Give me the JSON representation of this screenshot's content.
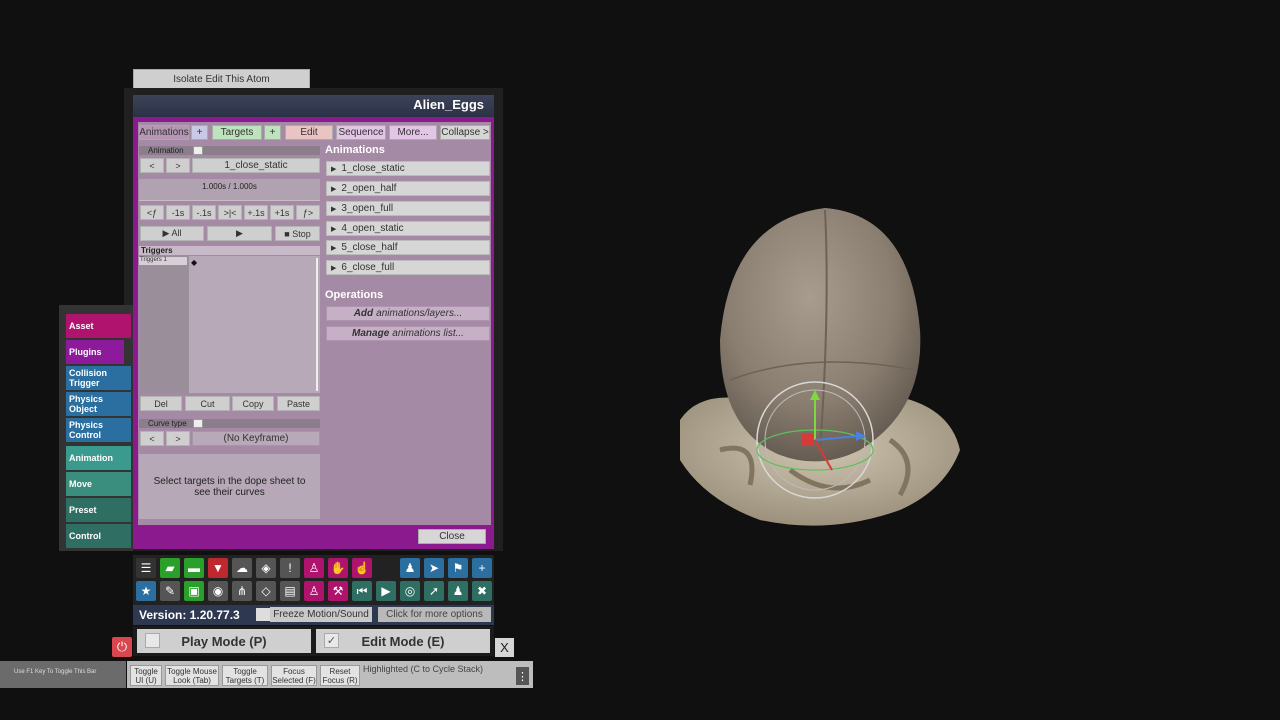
{
  "isolate_label": "Isolate Edit This Atom",
  "window_title": "Alien_Eggs",
  "tabs": [
    {
      "label": "Animations",
      "color": "#b596b5"
    },
    {
      "label": "+",
      "color": "#c9c9e6"
    },
    {
      "label": "Targets",
      "color": "#bde3bd"
    },
    {
      "label": "+",
      "color": "#bde3bd"
    },
    {
      "label": "Edit",
      "color": "#eac3c3"
    },
    {
      "label": "Sequence",
      "color": "#e3c5e6"
    },
    {
      "label": "More...",
      "color": "#e3c5e6"
    },
    {
      "label": "Collapse >",
      "color": "#d6d6d6"
    }
  ],
  "animation_label": "Animation",
  "prev": "<",
  "next": ">",
  "current_animation": "1_close_static",
  "time_text": "1.000s / 1.000s",
  "nav_buttons": [
    "<ƒ",
    "-1s",
    "-.1s",
    ">|<",
    "+.1s",
    "+1s",
    "ƒ>"
  ],
  "play_all": "▶ All",
  "play": "▶",
  "stop": "■ Stop",
  "triggers_header": "Triggers",
  "triggers_row": "Triggers 1",
  "keyframe_marker": "◆",
  "edit_buttons": [
    "Del",
    "Cut",
    "Copy",
    "Paste"
  ],
  "curve_type_label": "Curve type",
  "no_keyframe": "(No Keyframe)",
  "curve_info": "Select targets in the dope sheet to see their curves",
  "animations_title": "Animations",
  "animations": [
    "1_close_static",
    "2_open_half",
    "3_open_full",
    "4_open_static",
    "5_close_half",
    "6_close_full"
  ],
  "operations_title": "Operations",
  "operations": [
    {
      "bold": "Add",
      "rest": "animations/layers..."
    },
    {
      "bold": "Manage",
      "rest": "animations list..."
    }
  ],
  "close_label": "Close",
  "side_menu": [
    {
      "label": "Asset",
      "color": "#b0136e"
    },
    {
      "label": "Plugins",
      "color": "#8d1a9a"
    },
    {
      "label": "Collision Trigger",
      "color": "#2a6fa0"
    },
    {
      "label": "Physics Object",
      "color": "#2a6fa0"
    },
    {
      "label": "Physics Control",
      "color": "#2a6fa0"
    },
    {
      "label": "Animation",
      "color": "#3a9a8e"
    },
    {
      "label": "Move",
      "color": "#3a8e7e"
    },
    {
      "label": "Preset",
      "color": "#2f6e62"
    },
    {
      "label": "Control",
      "color": "#2f6e62"
    }
  ],
  "toolbar_icons_row1": [
    {
      "name": "menu-icon",
      "glyph": "☰",
      "color": "#333333"
    },
    {
      "name": "open-scene-icon",
      "glyph": "▰",
      "color": "#2aa02a"
    },
    {
      "name": "folder-icon",
      "glyph": "▬",
      "color": "#2aa02a"
    },
    {
      "name": "save-icon",
      "glyph": "▼",
      "color": "#c0282f"
    },
    {
      "name": "cloud-upload-icon",
      "glyph": "☁",
      "color": "#555555"
    },
    {
      "name": "package-icon",
      "glyph": "◈",
      "color": "#555555"
    },
    {
      "name": "alert-icon",
      "glyph": "!",
      "color": "#555555"
    },
    {
      "name": "person-add-icon",
      "glyph": "♙",
      "color": "#b0136e"
    },
    {
      "name": "hand-icon",
      "glyph": "✋",
      "color": "#b0136e"
    },
    {
      "name": "pointer-hand-icon",
      "glyph": "☝",
      "color": "#b0136e"
    },
    {
      "name": "person-icon",
      "glyph": "♟",
      "color": "#2a6fa0"
    },
    {
      "name": "send-icon",
      "glyph": "➤",
      "color": "#2a6fa0"
    },
    {
      "name": "flag-icon",
      "glyph": "⚑",
      "color": "#2a6fa0"
    },
    {
      "name": "plus-icon",
      "glyph": "+",
      "color": "#2a6fa0"
    }
  ],
  "toolbar_icons_row2": [
    {
      "name": "star-icon",
      "glyph": "★",
      "color": "#2a6fa0"
    },
    {
      "name": "edit-scene-icon",
      "glyph": "✎",
      "color": "#555555"
    },
    {
      "name": "camera-folder-icon",
      "glyph": "▣",
      "color": "#2aa02a"
    },
    {
      "name": "camera-icon",
      "glyph": "◉",
      "color": "#555555"
    },
    {
      "name": "share-icon",
      "glyph": "⋔",
      "color": "#555555"
    },
    {
      "name": "box-icon",
      "glyph": "◇",
      "color": "#555555"
    },
    {
      "name": "document-icon",
      "glyph": "▤",
      "color": "#555555"
    },
    {
      "name": "person-remove-icon",
      "glyph": "♙",
      "color": "#b0136e"
    },
    {
      "name": "tool-icon",
      "glyph": "⚒",
      "color": "#b0136e"
    },
    {
      "name": "rewind-icon",
      "glyph": "⏮",
      "color": "#2f6e62"
    },
    {
      "name": "play-icon",
      "glyph": "▶",
      "color": "#2f6e62"
    },
    {
      "name": "target-icon",
      "glyph": "◎",
      "color": "#2f6e62"
    },
    {
      "name": "cursor-icon",
      "glyph": "➚",
      "color": "#2f6e62"
    },
    {
      "name": "people-icon",
      "glyph": "♟",
      "color": "#2f6e62"
    },
    {
      "name": "wrench-icon",
      "glyph": "✖",
      "color": "#2f6e62"
    }
  ],
  "version": "Version: 1.20.77.3",
  "freeze_label": "Freeze Motion/Sound",
  "more_options": "Click for more options",
  "play_mode": "Play Mode (P)",
  "edit_mode": "Edit Mode (E)",
  "edit_check": "✓",
  "power_glyph": "⏻",
  "x_label": "X",
  "f1_hint": "Use F1 Key To Toggle This Bar",
  "bottom_buttons": [
    "Toggle UI (U)",
    "Toggle Mouse Look (Tab)",
    "Toggle Targets (T)",
    "Focus Selected (F)",
    "Reset Focus (R)"
  ],
  "highlighted": "Highlighted (C to Cycle Stack)",
  "dots": "⋮"
}
